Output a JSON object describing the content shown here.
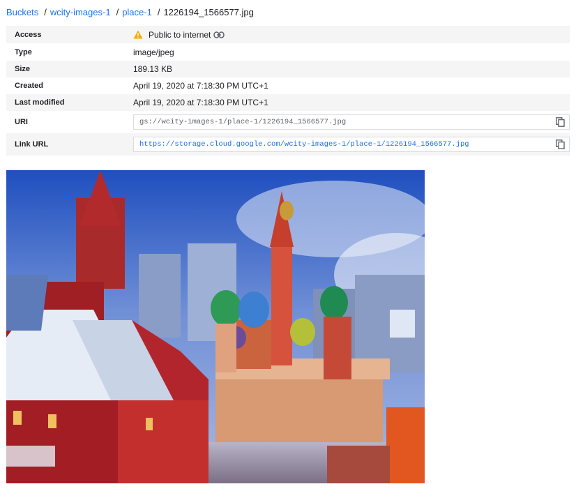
{
  "breadcrumb": {
    "buckets": "Buckets",
    "bucket": "wcity-images-1",
    "folder": "place-1",
    "file": "1226194_1566577.jpg"
  },
  "details": {
    "access_label": "Access",
    "access_value": "Public to internet",
    "type_label": "Type",
    "type_value": "image/jpeg",
    "size_label": "Size",
    "size_value": "189.13 KB",
    "created_label": "Created",
    "created_value": "April 19, 2020 at 7:18:30 PM UTC+1",
    "modified_label": "Last modified",
    "modified_value": "April 19, 2020 at 7:18:30 PM UTC+1",
    "uri_label": "URI",
    "uri_value": "gs://wcity-images-1/place-1/1226194_1566577.jpg",
    "link_label": "Link URL",
    "link_value": "https://storage.cloud.google.com/wcity-images-1/place-1/1226194_1566577.jpg"
  },
  "icons": {
    "warning": "warning-icon",
    "link": "link-icon",
    "copy": "copy-icon"
  },
  "colors": {
    "link": "#1a73e8",
    "warning": "#f9ab00",
    "row_shade": "#f5f5f5"
  }
}
